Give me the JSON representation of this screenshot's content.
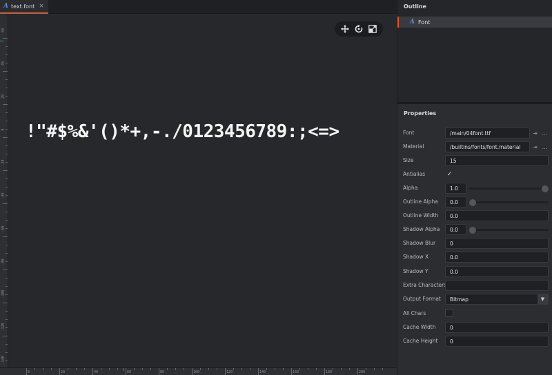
{
  "tab": {
    "icon": "font-file-icon",
    "label": "text.font",
    "close": "×"
  },
  "viewport": {
    "preview_text": "!\"#$%&'()*+,-./0123456789:;<=>",
    "vruler_labels": [
      "60",
      "40",
      "20",
      "0",
      "-20",
      "-40",
      "-60",
      "-80",
      "-100",
      "-120",
      "-140"
    ],
    "hruler_labels": [
      "0",
      "20",
      "40",
      "60",
      "80",
      "100",
      "120",
      "140",
      "160",
      "180",
      "200"
    ]
  },
  "manipulators": [
    {
      "icon": "move-icon",
      "label": "Move"
    },
    {
      "icon": "rotate-icon",
      "label": "Rotate"
    },
    {
      "icon": "scale-icon",
      "label": "Scale"
    }
  ],
  "outline": {
    "title": "Outline",
    "items": [
      {
        "icon": "font-file-icon",
        "label": "Font"
      }
    ]
  },
  "properties": {
    "title": "Properties",
    "font": {
      "label": "Font",
      "value": "/main/04font.ttf"
    },
    "material": {
      "label": "Material",
      "value": "/builtins/fonts/font.material"
    },
    "size": {
      "label": "Size",
      "value": "15"
    },
    "antialias": {
      "label": "Antialias",
      "checked": true,
      "mark": "✓"
    },
    "alpha": {
      "label": "Alpha",
      "value": "1.0",
      "level": 1.0
    },
    "outline_alpha": {
      "label": "Outline Alpha",
      "value": "0.0",
      "level": 0.0
    },
    "outline_width": {
      "label": "Outline Width",
      "value": "0.0"
    },
    "shadow_alpha": {
      "label": "Shadow Alpha",
      "value": "0.0",
      "level": 0.0
    },
    "shadow_blur": {
      "label": "Shadow Blur",
      "value": "0"
    },
    "shadow_x": {
      "label": "Shadow X",
      "value": "0.0"
    },
    "shadow_y": {
      "label": "Shadow Y",
      "value": "0.0"
    },
    "extra_characters": {
      "label": "Extra Characters",
      "value": ""
    },
    "output_format": {
      "label": "Output Format",
      "value": "Bitmap",
      "caret": "▼"
    },
    "all_chars": {
      "label": "All Chars",
      "checked": false
    },
    "cache_width": {
      "label": "Cache Width",
      "value": "0"
    },
    "cache_height": {
      "label": "Cache Height",
      "value": "0"
    },
    "path_buttons": {
      "goto": "⇥",
      "browse": "…"
    }
  },
  "colors": {
    "accent": "#e0572c",
    "font_icon": "#5b8fd6",
    "origin_y": "#3fa55a",
    "origin_x": "#d64545"
  }
}
